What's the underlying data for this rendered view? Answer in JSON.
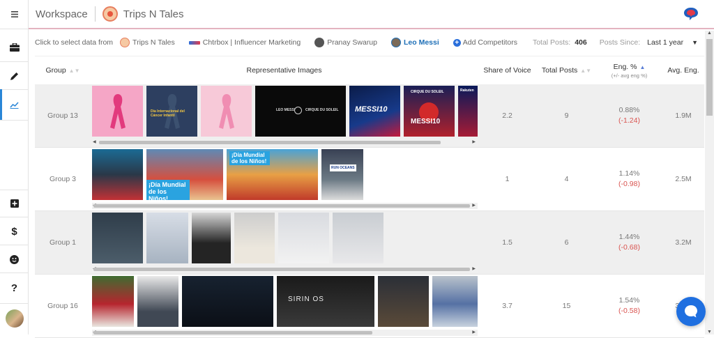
{
  "topbar": {
    "workspace_label": "Workspace",
    "brand_name": "Trips N Tales"
  },
  "filters": {
    "prompt": "Click to select data from",
    "sources": [
      {
        "label": "Trips N Tales",
        "active": false
      },
      {
        "label": "Chtrbox | Influencer Marketing",
        "active": false
      },
      {
        "label": "Pranay Swarup",
        "active": false
      },
      {
        "label": "Leo Messi",
        "active": true
      }
    ],
    "add_competitors": "Add Competitors",
    "total_posts_label": "Total Posts:",
    "total_posts_value": "406",
    "posts_since_label": "Posts Since:",
    "posts_since_value": "Last 1 year"
  },
  "table": {
    "headers": {
      "group": "Group",
      "images": "Representative Images",
      "sov": "Share of Voice",
      "total_posts": "Total Posts",
      "eng": "Eng. %",
      "eng_sub": "(+/- avg eng %)",
      "avg_eng": "Avg. Eng."
    },
    "rows": [
      {
        "group": "Group 13",
        "sov": "2.2",
        "total_posts": "9",
        "eng": "0.88%",
        "eng_delta": "(-1.24)",
        "avg_eng": "1.9M"
      },
      {
        "group": "Group 3",
        "sov": "1",
        "total_posts": "4",
        "eng": "1.14%",
        "eng_delta": "(-0.98)",
        "avg_eng": "2.5M"
      },
      {
        "group": "Group 1",
        "sov": "1.5",
        "total_posts": "6",
        "eng": "1.44%",
        "eng_delta": "(-0.68)",
        "avg_eng": "3.2M"
      },
      {
        "group": "Group 16",
        "sov": "3.7",
        "total_posts": "15",
        "eng": "1.54%",
        "eng_delta": "(-0.58)",
        "avg_eng": "3.4M"
      }
    ]
  },
  "thumb_text": {
    "cancer_day": "Día Internacional del Cáncer Infantil",
    "leo_messi": "LEO MESSI",
    "messi10": "MESSI10",
    "cirque": "CIRQUE DU SOLEIL",
    "rakuten": "Rakuten",
    "dia_mundial": "¡Día Mundial de los Niños!",
    "dia_mundial_short": "¡Día Mundial de los Niños!",
    "run_oceans": "RUN OCEANS",
    "sirin": "SIRIN OS"
  },
  "colors": {
    "accent": "#2a86d7",
    "negative": "#d9534f",
    "chat": "#1f6fe0"
  },
  "icons": [
    "hamburger-icon",
    "briefcase-icon",
    "pencil-icon",
    "chart-icon",
    "plus-square-icon",
    "dollar-icon",
    "smiley-icon",
    "question-icon",
    "chat-icon"
  ]
}
